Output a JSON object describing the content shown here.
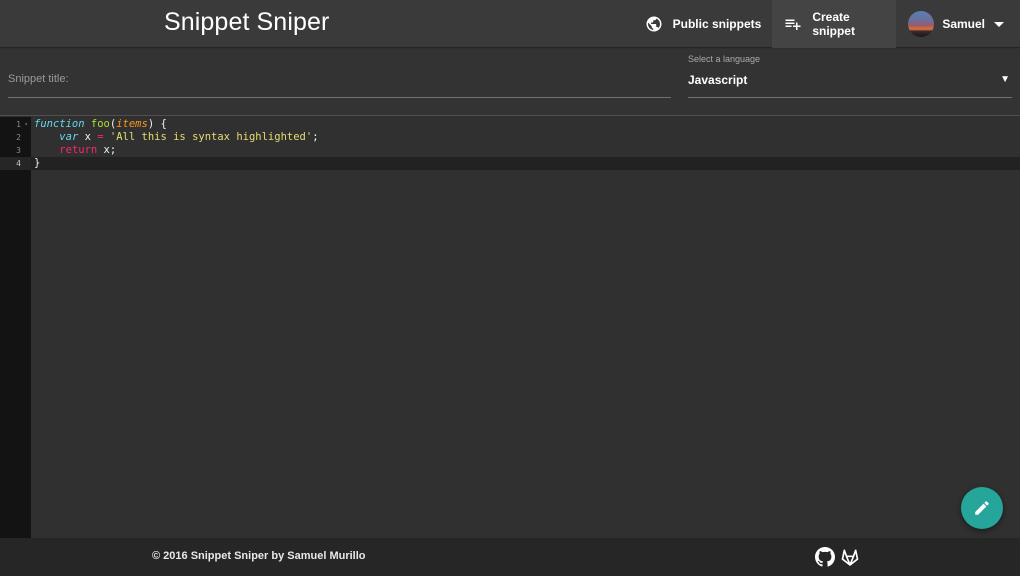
{
  "header": {
    "brand": "Snippet Sniper",
    "nav": {
      "public_label": "Public snippets",
      "public_icon": "globe-icon",
      "create_label": "Create snippet",
      "create_icon": "playlist-add-icon",
      "user_name": "Samuel",
      "user_menu_icon": "caret-down-icon"
    }
  },
  "form": {
    "title_placeholder": "Snippet title:",
    "title_value": "",
    "language_label": "Select a language",
    "language_value": "Javascript"
  },
  "editor": {
    "line_numbers": [
      "1",
      "2",
      "3",
      "4"
    ],
    "code": {
      "line1": {
        "kw": "function",
        "sp1": " ",
        "fn": "foo",
        "p1": "(",
        "param": "items",
        "p2": ") {"
      },
      "line2": {
        "indent": "    ",
        "kw": "var",
        "mid": " x ",
        "op": "=",
        "sp": " ",
        "str": "'All this is syntax highlighted'",
        "end": ";"
      },
      "line3": {
        "indent": "    ",
        "kw": "return",
        "end": " x;"
      },
      "line4": {
        "text": "}"
      }
    },
    "theme_colors": {
      "storage": "#66d9ef",
      "function": "#a6e22e",
      "param": "#fd971f",
      "keyword": "#f92672",
      "string": "#e6db74"
    }
  },
  "fab": {
    "icon": "pencil-icon",
    "color": "#26a69a"
  },
  "footer": {
    "copyright": "© 2016 Snippet Sniper by Samuel Murillo",
    "icons": [
      "github-icon",
      "gitlab-icon"
    ]
  }
}
